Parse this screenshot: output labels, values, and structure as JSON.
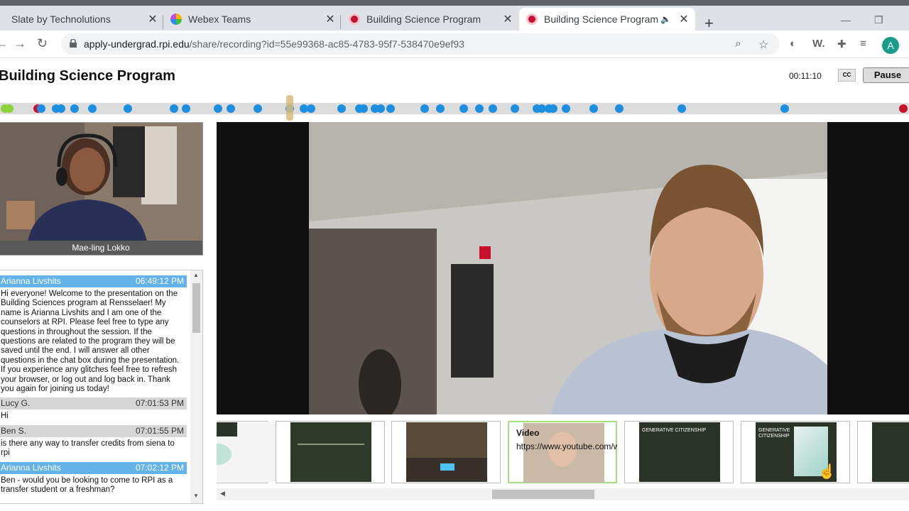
{
  "browser": {
    "tabs": [
      {
        "title": "Slate by Technolutions",
        "active": false
      },
      {
        "title": "Webex Teams",
        "active": false
      },
      {
        "title": "Building Science Program",
        "active": false
      },
      {
        "title": "Building Science Program",
        "active": true
      }
    ],
    "url_domain": "apply-undergrad.rpi.edu",
    "url_path": "/share/recording?id=55e99368-ac85-4783-95f7-538470e9ef93",
    "profile_initial": "A"
  },
  "player": {
    "title": "Building Science Program",
    "time": "00:11:10",
    "cc_label": "CC",
    "pause_label": "Pause",
    "progress_fraction": 0.32,
    "webcam_name": "Mae-ling Lokko"
  },
  "chat": [
    {
      "sender": "Arianna Livshits",
      "time": "06:49:12 PM",
      "host": true,
      "text": "Hi everyone! Welcome to the presentation on the Building Sciences program at Rensselaer! My name is Arianna Livshits and I am one of the counselors at RPI. Please feel free to type any questions in throughout the session. If the questions are related to the program they will be saved until the end. I will answer all other questions in the chat box during the presentation. If you experience any glitches feel free to refresh your browser, or log out and log back in. Thank you again for joining us today!"
    },
    {
      "sender": "Lucy G.",
      "time": "07:01:53 PM",
      "host": false,
      "text": "Hi"
    },
    {
      "sender": "Ben S.",
      "time": "07:01:55 PM",
      "host": false,
      "text": "is there any way to transfer credits from siena to rpi"
    },
    {
      "sender": "Arianna Livshits",
      "time": "07:02:12 PM",
      "host": true,
      "text": "Ben - would you be looking to come to RPI as a transfer student or a freshman?"
    }
  ],
  "slides": {
    "video_label": "Video",
    "video_url": "https://www.youtube.com/wa",
    "slide_title_1": "GENERATIVE CITIZENSHIP",
    "slide_title_2": "GENERATIVE CITIZENSHIP"
  },
  "colors": {
    "marker": "#1e8fe0",
    "chat_host": "#63b2e9",
    "selected_thumb": "#a3e07a"
  }
}
